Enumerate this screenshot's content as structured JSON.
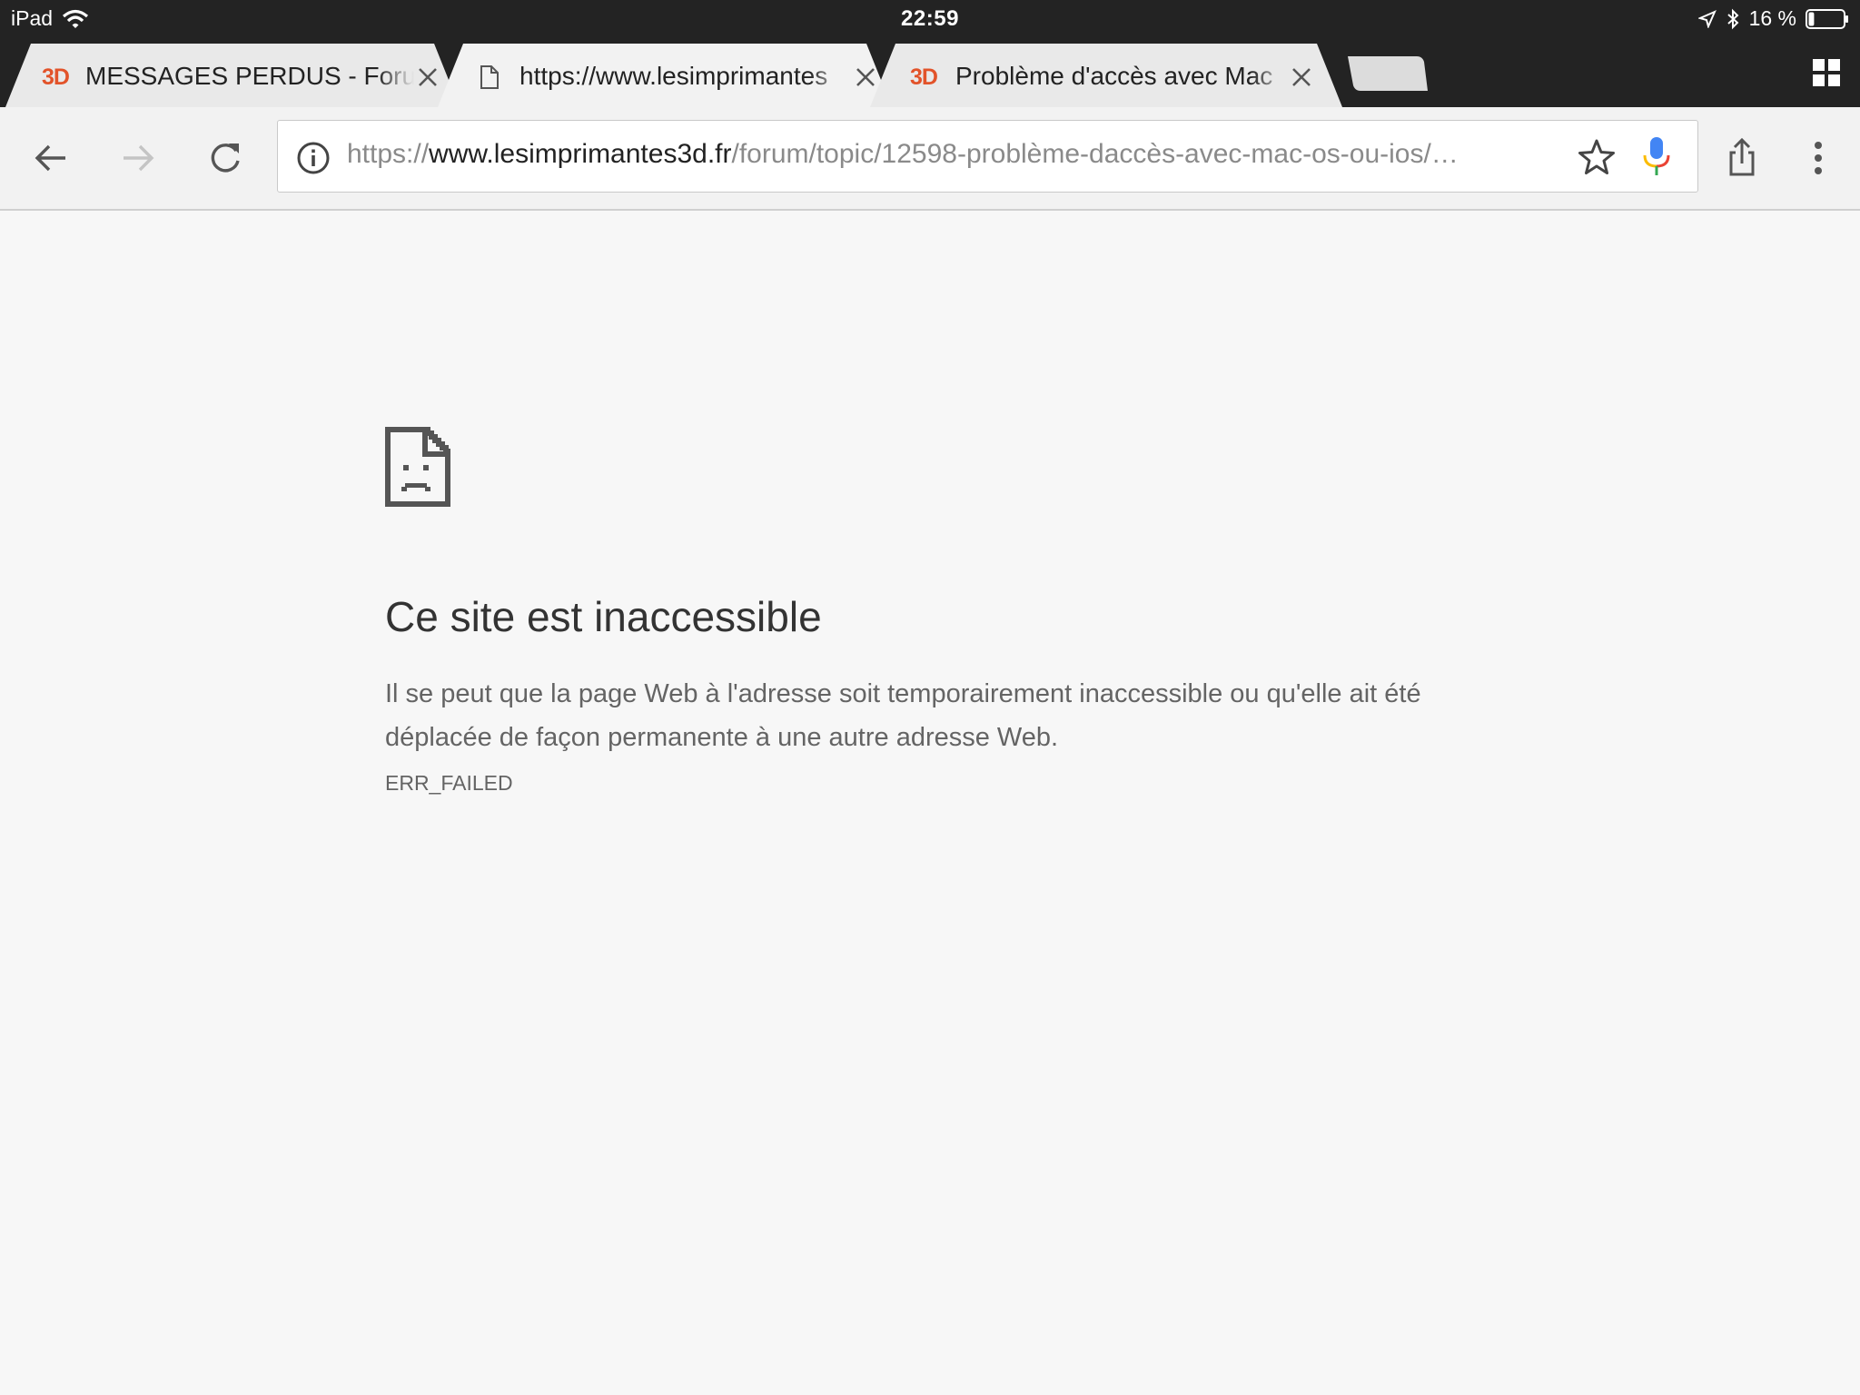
{
  "status_bar": {
    "device": "iPad",
    "time": "22:59",
    "battery": "16 %",
    "battery_level": 0.16
  },
  "tabs": [
    {
      "title": "MESSAGES PERDUS - Forum",
      "favicon": "3D",
      "active": false
    },
    {
      "title": "https://www.lesimprimantes",
      "favicon": "page-icon",
      "active": true
    },
    {
      "title": "Problème d'accès avec Mac",
      "favicon": "3D",
      "active": false
    }
  ],
  "omnibox": {
    "scheme": "https://",
    "host": "www.lesimprimantes3d.fr",
    "path": "/forum/topic/12598-problème-daccès-avec-mac-os-ou-ios/…"
  },
  "error": {
    "heading": "Ce site est inaccessible",
    "line1": "Il se peut que la page Web à l'adresse soit temporairement inaccessible ou qu'elle ait été",
    "line2": "déplacée de façon permanente à une autre adresse Web.",
    "code": "ERR_FAILED"
  },
  "colors": {
    "chrome_dark": "#232323",
    "tab_bg": "#e9e9e9",
    "toolbar_bg": "#f2f2f2",
    "favicon_accent": "#e2532a",
    "content_bg": "#f7f7f7"
  },
  "icons": [
    "wifi-icon",
    "location-arrow-icon",
    "bluetooth-icon",
    "battery-icon",
    "page-icon",
    "close-icon",
    "new-tab-icon",
    "tab-switcher-icon",
    "back-icon",
    "forward-icon",
    "reload-icon",
    "info-icon",
    "star-icon",
    "mic-icon",
    "share-icon",
    "menu-icon",
    "sad-page-icon"
  ]
}
